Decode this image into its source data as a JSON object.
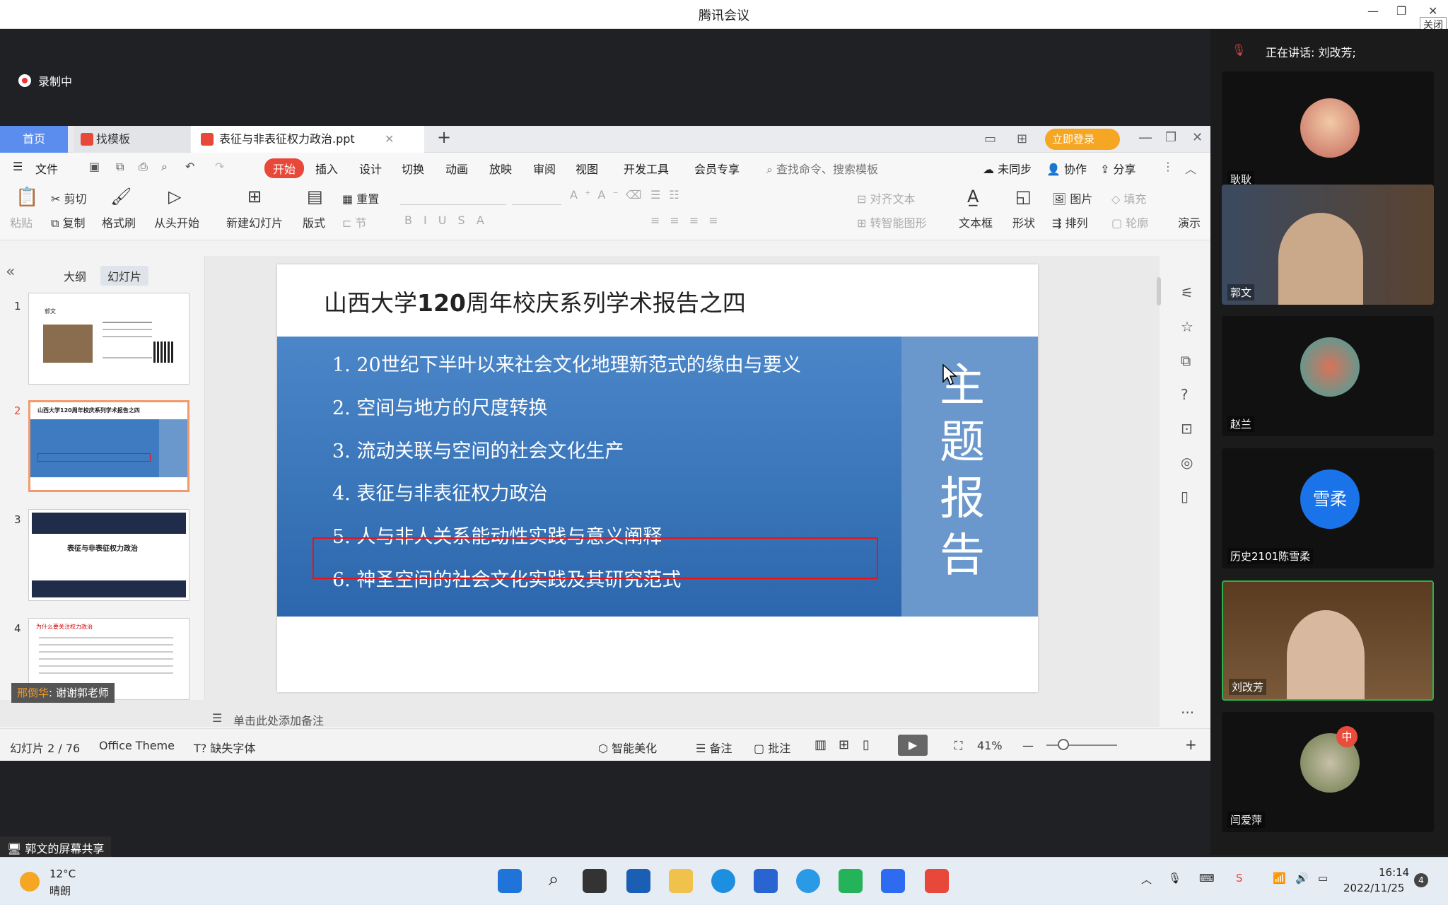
{
  "window": {
    "title": "腾讯会议",
    "close_tip": "关闭"
  },
  "recording": {
    "label": "录制中"
  },
  "wps": {
    "tabs": [
      {
        "label": "首页"
      },
      {
        "label": "找模板"
      },
      {
        "label": "表征与非表征权力政治.ppt"
      }
    ],
    "login_button": "立即登录",
    "menu": {
      "file": "文件",
      "items": [
        "开始",
        "插入",
        "设计",
        "切换",
        "动画",
        "放映",
        "审阅",
        "视图",
        "开发工具",
        "会员专享"
      ],
      "search_placeholder": "查找命令、搜索模板",
      "sync": "未同步",
      "collab": "协作",
      "share": "分享"
    },
    "ribbon": {
      "paste": "粘贴",
      "cut": "剪切",
      "copy": "复制",
      "format_painter": "格式刷",
      "from_start": "从头开始",
      "new_slide": "新建幻灯片",
      "layout": "版式",
      "reset": "重置",
      "section": "节",
      "align_text": "对齐文本",
      "to_smartart": "转智能图形",
      "textbox": "文本框",
      "shape": "形状",
      "picture": "图片",
      "arrange": "排列",
      "fill": "填充",
      "outline": "轮廓",
      "present": "演示"
    },
    "panel_tabs": {
      "outline": "大纲",
      "slides": "幻灯片"
    },
    "thumbnails": [
      {
        "num": "1",
        "caption": "郭文"
      },
      {
        "num": "2",
        "caption": "山西大学120周年校庆系列学术报告之四"
      },
      {
        "num": "3",
        "caption": "表征与非表征权力政治"
      },
      {
        "num": "4",
        "caption": "为什么要关注权力政治"
      }
    ],
    "presenter_label": {
      "name": "邢倒华",
      "message": "谢谢郭老师"
    },
    "slide": {
      "title_pre": "山西大学",
      "title_num": "120",
      "title_post": "周年校庆系列学术报告之四",
      "items": [
        "1. 20世纪下半叶以来社会文化地理新范式的缘由与要义",
        "2. 空间与地方的尺度转换",
        "3. 流动关联与空间的社会文化生产",
        "4. 表征与非表征权力政治",
        "5. 人与非人关系能动性实践与意义阐释",
        "6. 神圣空间的社会文化实践及其研究范式"
      ],
      "side_chars": [
        "主",
        "题",
        "报",
        "告"
      ]
    },
    "notes_placeholder": "单击此处添加备注",
    "status": {
      "slide_counter": "幻灯片 2 / 76",
      "theme": "Office Theme",
      "missing_font": "缺失字体",
      "beautify": "智能美化",
      "notes": "备注",
      "comment": "批注",
      "zoom": "41%"
    }
  },
  "share_bar": {
    "label": "郭文的屏幕共享"
  },
  "participants": {
    "speaking": "正在讲话: 刘改芳;",
    "list": [
      {
        "name": "耿耿"
      },
      {
        "name": "郭文"
      },
      {
        "name": "赵兰"
      },
      {
        "name": "历史2101陈雪柔",
        "initials": "雪柔"
      },
      {
        "name": "刘改芳"
      },
      {
        "name": "闫爱萍",
        "badge": "中"
      }
    ]
  },
  "taskbar": {
    "weather_temp": "12°C",
    "weather_text": "晴朗",
    "time": "16:14",
    "date": "2022/11/25",
    "notif_count": "4"
  }
}
